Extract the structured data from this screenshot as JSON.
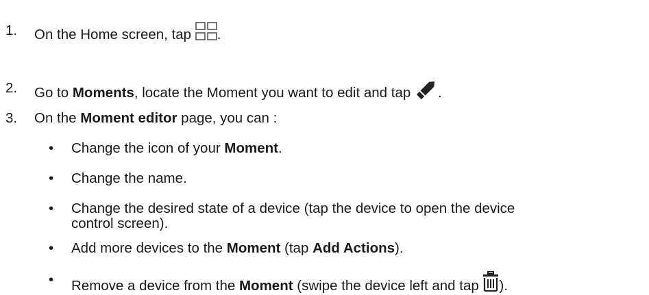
{
  "steps": [
    {
      "number": "1.",
      "text_before": "On the Home screen, tap ",
      "icon": "grid-icon",
      "text_after": "."
    },
    {
      "number": "2.",
      "text_a": "Go to ",
      "bold_a": "Moments",
      "text_b": ", locate the Moment you want to edit and tap ",
      "icon": "pencil-icon",
      "text_after": "."
    },
    {
      "number": "3.",
      "text_a": "On the ",
      "bold_a": "Moment editor",
      "text_b": " page, you can :"
    }
  ],
  "bullets": [
    {
      "bullet": "•",
      "text_a": "Change the icon of your ",
      "bold_a": "Moment",
      "text_b": "."
    },
    {
      "bullet": "•",
      "text_a": "Change the name."
    },
    {
      "bullet": "•",
      "line1": "Change the desired state of a device (tap the device to open the device",
      "line2": "control screen)."
    },
    {
      "bullet": "•",
      "text_a": "Add more devices to the ",
      "bold_a": "Moment",
      "text_b": " (tap ",
      "bold_b": "Add Actions",
      "text_c": ")."
    },
    {
      "bullet": "•",
      "text_a": "Remove a device from the ",
      "bold_a": "Moment",
      "text_b": " (swipe the device left and tap ",
      "icon": "trash-icon",
      "text_c": ")."
    }
  ],
  "colors": {
    "text": "#1a1a1a",
    "icon": "#222222",
    "grid_icon_stroke": "#555555"
  }
}
